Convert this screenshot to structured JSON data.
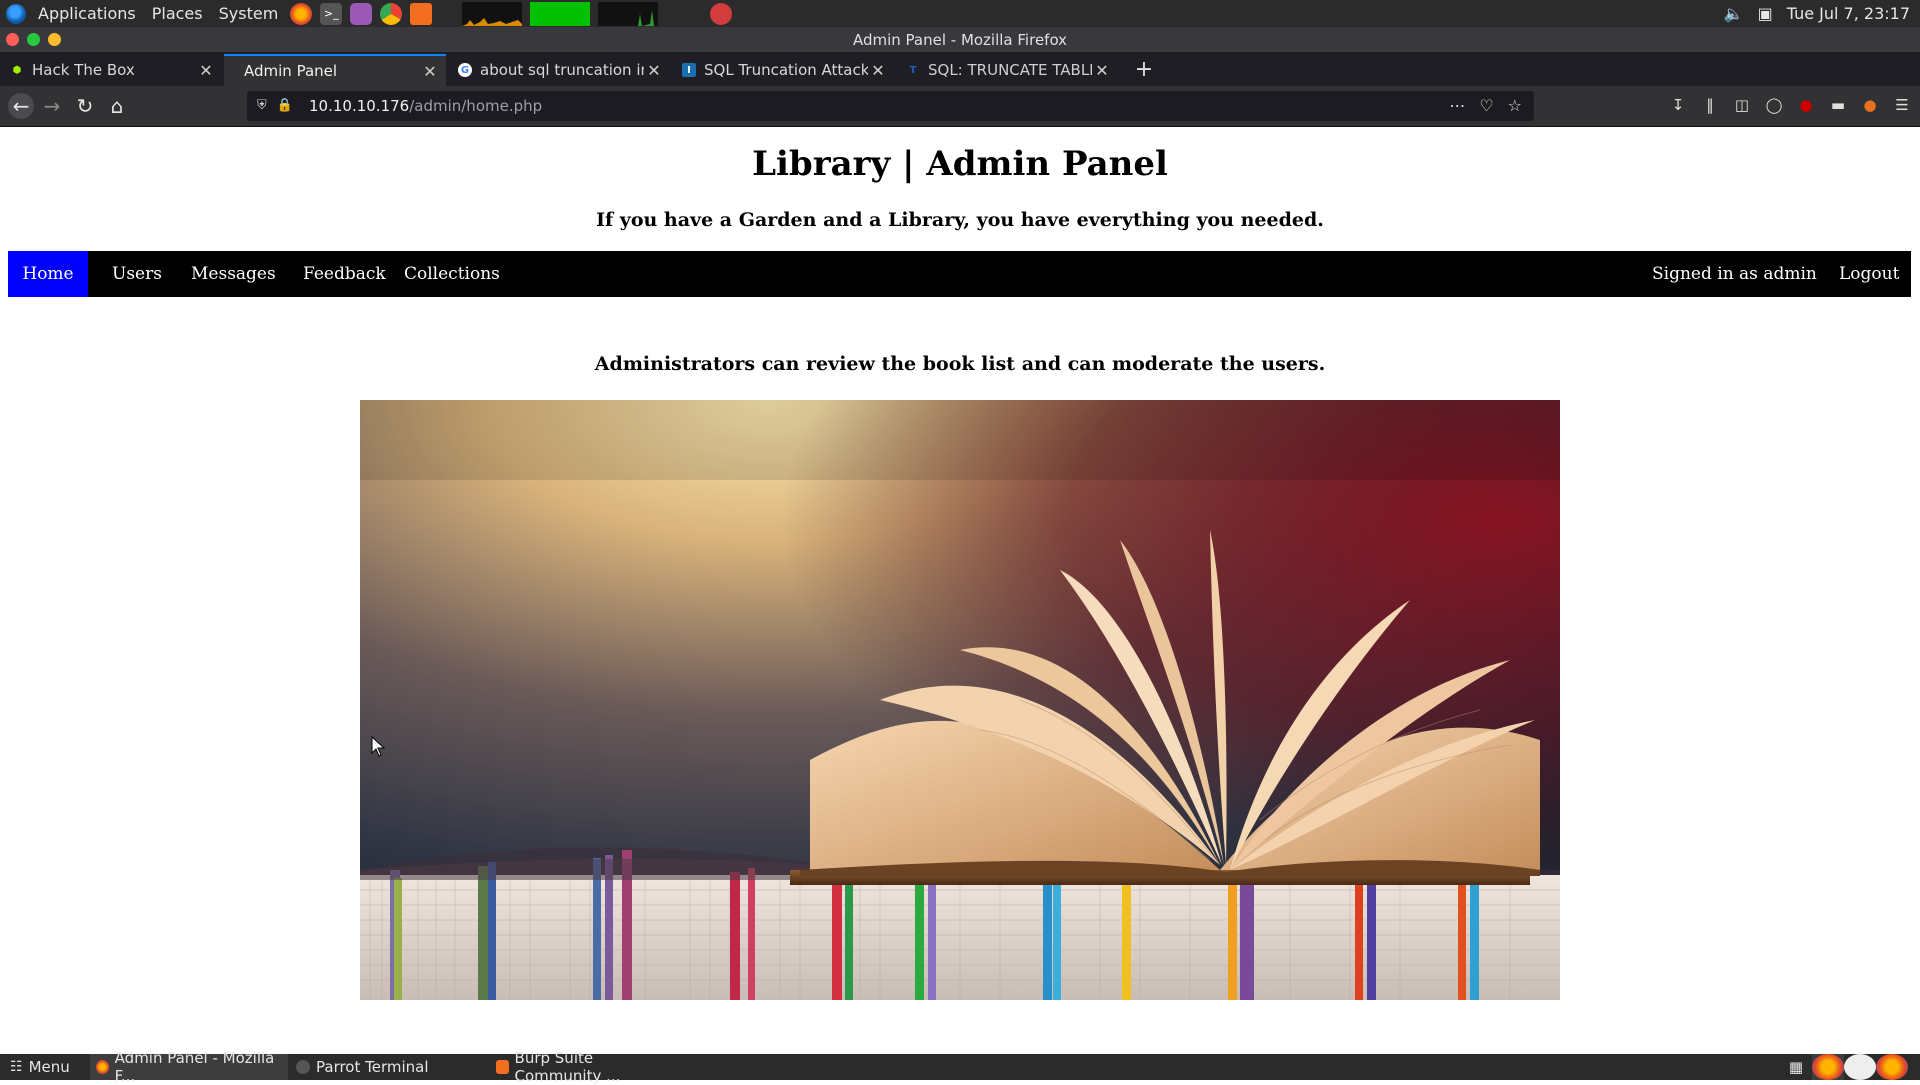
{
  "system_panel": {
    "applications": "Applications",
    "places": "Places",
    "system": "System",
    "clock": "Tue Jul 7, 23:17"
  },
  "window": {
    "title": "Admin Panel - Mozilla Firefox"
  },
  "tabs": [
    {
      "label": "Hack The Box",
      "icon": "htb-cube-icon",
      "active": false
    },
    {
      "label": "Admin Panel",
      "icon": "none",
      "active": true
    },
    {
      "label": "about sql truncation in p",
      "icon": "google-icon",
      "active": false
    },
    {
      "label": "SQL Truncation Attack",
      "icon": "i-logo-icon",
      "active": false
    },
    {
      "label": "SQL: TRUNCATE TABLE",
      "icon": "t-logo-icon",
      "active": false
    }
  ],
  "urlbar": {
    "host": "10.10.10.176",
    "path": "/admin/home.php"
  },
  "page": {
    "title": "Library | Admin Panel",
    "subtitle": "If you have a Garden and a Library, you have everything you needed.",
    "nav_left": [
      "Home",
      "Users",
      "Messages",
      "Feedback",
      "Collections"
    ],
    "nav_active": "Home",
    "signed_in": "Signed in as admin",
    "logout": "Logout",
    "admin_note": "Administrators can review the book list and can moderate the users."
  },
  "taskbar": {
    "menu": "Menu",
    "items": [
      "Admin Panel - Mozilla F...",
      "Parrot Terminal",
      "Burp Suite Community ..."
    ]
  },
  "colors": {
    "nav_active_bg": "#0000ff",
    "nav_bg": "#000000",
    "tab_accent": "#0a84ff"
  }
}
